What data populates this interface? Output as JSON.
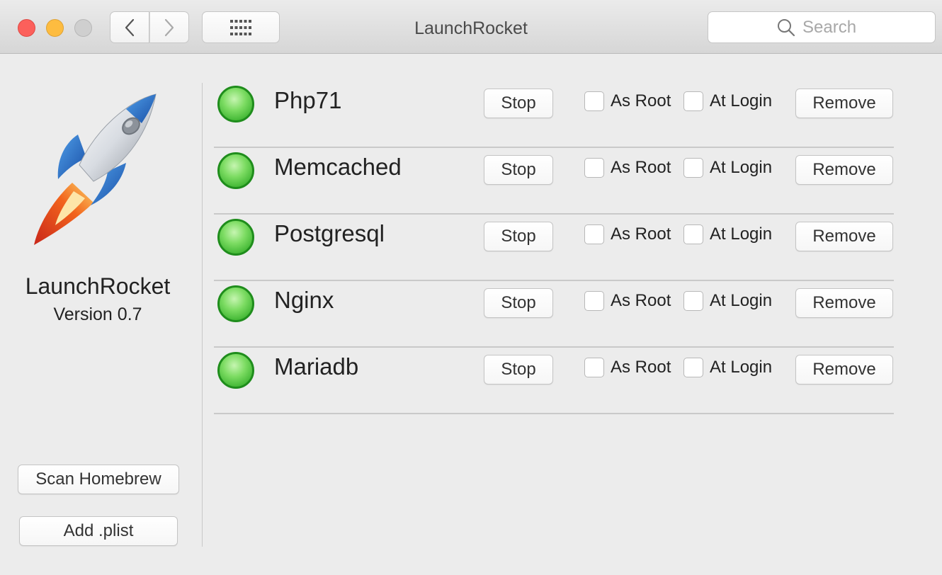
{
  "window": {
    "title": "LaunchRocket"
  },
  "toolbar": {
    "search_placeholder": "Search"
  },
  "sidebar": {
    "app_name": "LaunchRocket",
    "version": "Version 0.7",
    "scan_label": "Scan Homebrew",
    "add_label": "Add .plist"
  },
  "services": [
    {
      "name": "Php71",
      "status": "running",
      "stop_label": "Stop",
      "as_root_label": "As Root",
      "at_login_label": "At Login",
      "remove_label": "Remove",
      "as_root": false,
      "at_login": false
    },
    {
      "name": "Memcached",
      "status": "running",
      "stop_label": "Stop",
      "as_root_label": "As Root",
      "at_login_label": "At Login",
      "remove_label": "Remove",
      "as_root": false,
      "at_login": false
    },
    {
      "name": "Postgresql",
      "status": "running",
      "stop_label": "Stop",
      "as_root_label": "As Root",
      "at_login_label": "At Login",
      "remove_label": "Remove",
      "as_root": false,
      "at_login": false
    },
    {
      "name": "Nginx",
      "status": "running",
      "stop_label": "Stop",
      "as_root_label": "As Root",
      "at_login_label": "At Login",
      "remove_label": "Remove",
      "as_root": false,
      "at_login": false
    },
    {
      "name": "Mariadb",
      "status": "running",
      "stop_label": "Stop",
      "as_root_label": "As Root",
      "at_login_label": "At Login",
      "remove_label": "Remove",
      "as_root": false,
      "at_login": false
    }
  ],
  "colors": {
    "status_running": "#4cc23a",
    "traffic_close": "#fc605b",
    "traffic_minimize": "#fdbc40",
    "traffic_zoom_disabled": "#cfcfcf"
  },
  "icons": {
    "logo": "rocket-icon",
    "back": "chevron-left-icon",
    "forward": "chevron-right-icon",
    "grid": "grid-icon",
    "search": "search-icon"
  }
}
